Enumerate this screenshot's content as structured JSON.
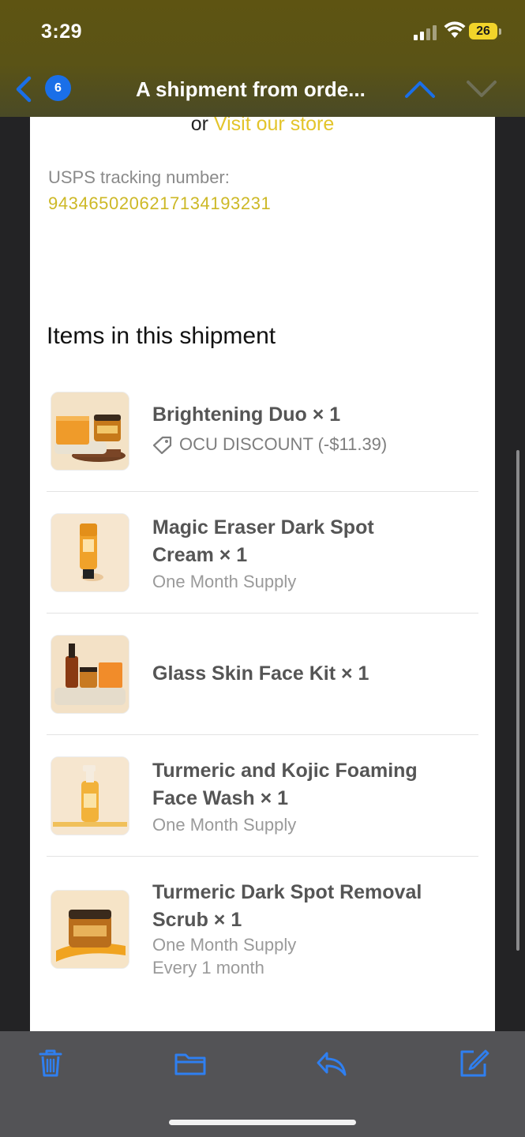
{
  "status_bar": {
    "time": "3:29",
    "battery": "26"
  },
  "nav": {
    "badge_count": "6",
    "title": "A shipment from orde...",
    "colors": {
      "accent": "#1a6fe8",
      "disabled": "#6f6f57"
    }
  },
  "email": {
    "store_prefix": "or ",
    "store_link": "Visit our store",
    "tracking_label": "USPS tracking number:",
    "tracking_number": "9434650206217134193231",
    "items_heading": "Items in this shipment",
    "items": [
      {
        "title_line1": "Brightening Duo × 1",
        "discount": "OCU DISCOUNT (-$11.39)"
      },
      {
        "title_line1": "Magic Eraser Dark Spot",
        "title_line2": "Cream × 1",
        "subtitle": "One Month Supply"
      },
      {
        "title_line1": "Glass Skin Face Kit × 1"
      },
      {
        "title_line1": "Turmeric and Kojic Foaming",
        "title_line2": "Face Wash × 1",
        "subtitle": "One Month Supply"
      },
      {
        "title_line1": "Turmeric Dark Spot Removal",
        "title_line2": "Scrub × 1",
        "subtitle": "One Month Supply",
        "subtitle2": "Every 1 month"
      }
    ]
  },
  "toolbar": {
    "icons": [
      "trash-icon",
      "folder-icon",
      "reply-icon",
      "compose-icon"
    ]
  }
}
